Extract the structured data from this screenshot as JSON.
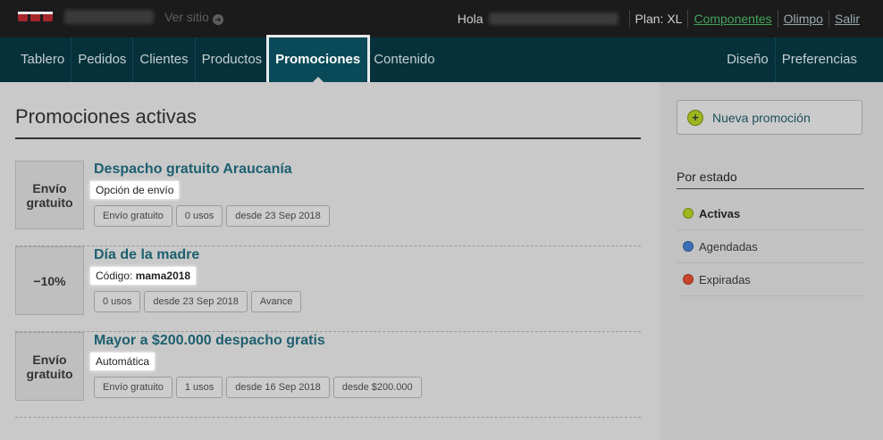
{
  "topbar": {
    "ver_sitio": "Ver sitio",
    "greeting": "Hola",
    "plan": "Plan: XL",
    "links": [
      "Componentes",
      "Olimpo",
      "Salir"
    ]
  },
  "nav": {
    "left": [
      "Tablero",
      "Pedidos",
      "Clientes",
      "Productos",
      "Promociones",
      "Contenido"
    ],
    "right": [
      "Diseño",
      "Preferencias"
    ],
    "active": "Promociones"
  },
  "main": {
    "title": "Promociones activas",
    "promos": [
      {
        "box_lines": [
          "Envío",
          "gratuito"
        ],
        "title": "Despacho gratuito Araucanía",
        "sub_label": "Opción de envío",
        "sub_value": "",
        "tags": [
          "Envío gratuito",
          "0 usos",
          "desde 23 Sep 2018"
        ]
      },
      {
        "box_lines": [
          "−10%"
        ],
        "title": "Día de la madre",
        "sub_label": "Código: ",
        "sub_value": "mama2018",
        "tags": [
          "0 usos",
          "desde 23 Sep 2018",
          "Avance"
        ]
      },
      {
        "box_lines": [
          "Envío",
          "gratuito"
        ],
        "title": "Mayor a $200.000 despacho gratis",
        "sub_label": "Automática",
        "sub_value": "",
        "tags": [
          "Envío gratuito",
          "1 usos",
          "desde 16 Sep 2018",
          "desde $200.000"
        ]
      }
    ]
  },
  "sidebar": {
    "new_button": "Nueva promoción",
    "heading": "Por estado",
    "statuses": [
      {
        "label": "Activas",
        "color": "#9fb51d",
        "active": true
      },
      {
        "label": "Agendadas",
        "color": "#3a6fb7",
        "active": false
      },
      {
        "label": "Expiradas",
        "color": "#c8452a",
        "active": false
      }
    ]
  },
  "colors": {
    "nav_bg": "#06313b",
    "nav_active": "#0a4a58",
    "link_green": "#43a35b",
    "promo_title": "#1d5f70"
  }
}
